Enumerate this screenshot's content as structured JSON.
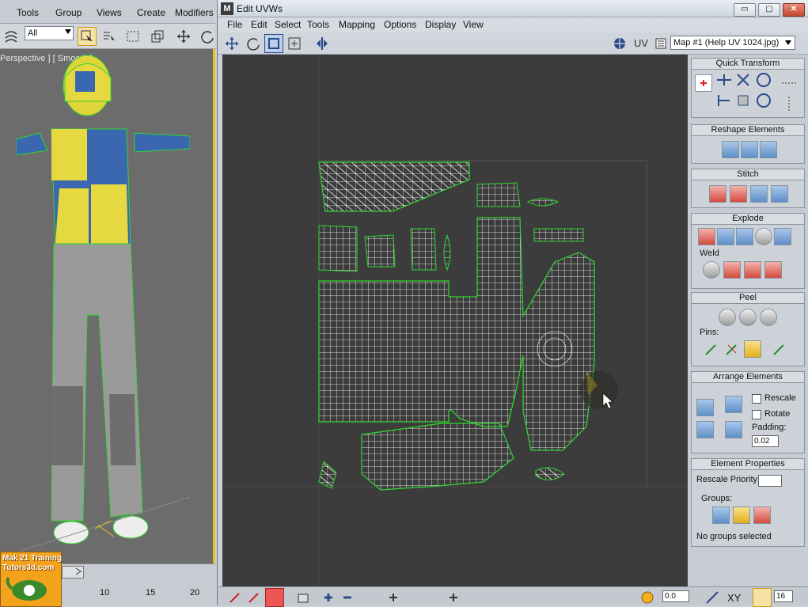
{
  "max": {
    "menu": [
      "Tools",
      "Group",
      "Views",
      "Create",
      "Modifiers"
    ],
    "selection_filter": "All",
    "viewport_label": "Perspective ] [ Smooth ]",
    "timeline_ticks": [
      "10",
      "15",
      "20"
    ],
    "logo_line1": "Mak 21 Training",
    "logo_line2": "Tutors3d.com"
  },
  "uvw": {
    "title": "Edit UVWs",
    "menu": [
      "File",
      "Edit",
      "Select",
      "Tools",
      "Mapping",
      "Options",
      "Display",
      "View"
    ],
    "uv_label": "UV",
    "map_select": "Map #1 (Help UV 1024.jpg)",
    "win_buttons": {
      "minimize": "▭",
      "restore": "▢",
      "close": "✕"
    }
  },
  "panel": {
    "quick_transform": "Quick Transform",
    "reshape_elements": "Reshape Elements",
    "stitch": "Stitch",
    "explode": "Explode",
    "weld": "Weld",
    "peel": "Peel",
    "pins": "Pins:",
    "arrange_elements": "Arrange Elements",
    "rescale": "Rescale",
    "rotate": "Rotate",
    "padding_label": "Padding:",
    "padding_value": "0.02",
    "element_properties": "Element Properties",
    "rescale_priority": "Rescale Priority:",
    "groups": "Groups:",
    "no_groups": "No groups selected"
  },
  "bottom": {
    "value": "0.0",
    "xy": "XY",
    "count": "16"
  },
  "colors": {
    "accent_yellow": "#e8c21a",
    "uv_bg": "#3c3c3c",
    "uv_wire": "#ffffff",
    "uv_selected": "#2fd92f"
  }
}
